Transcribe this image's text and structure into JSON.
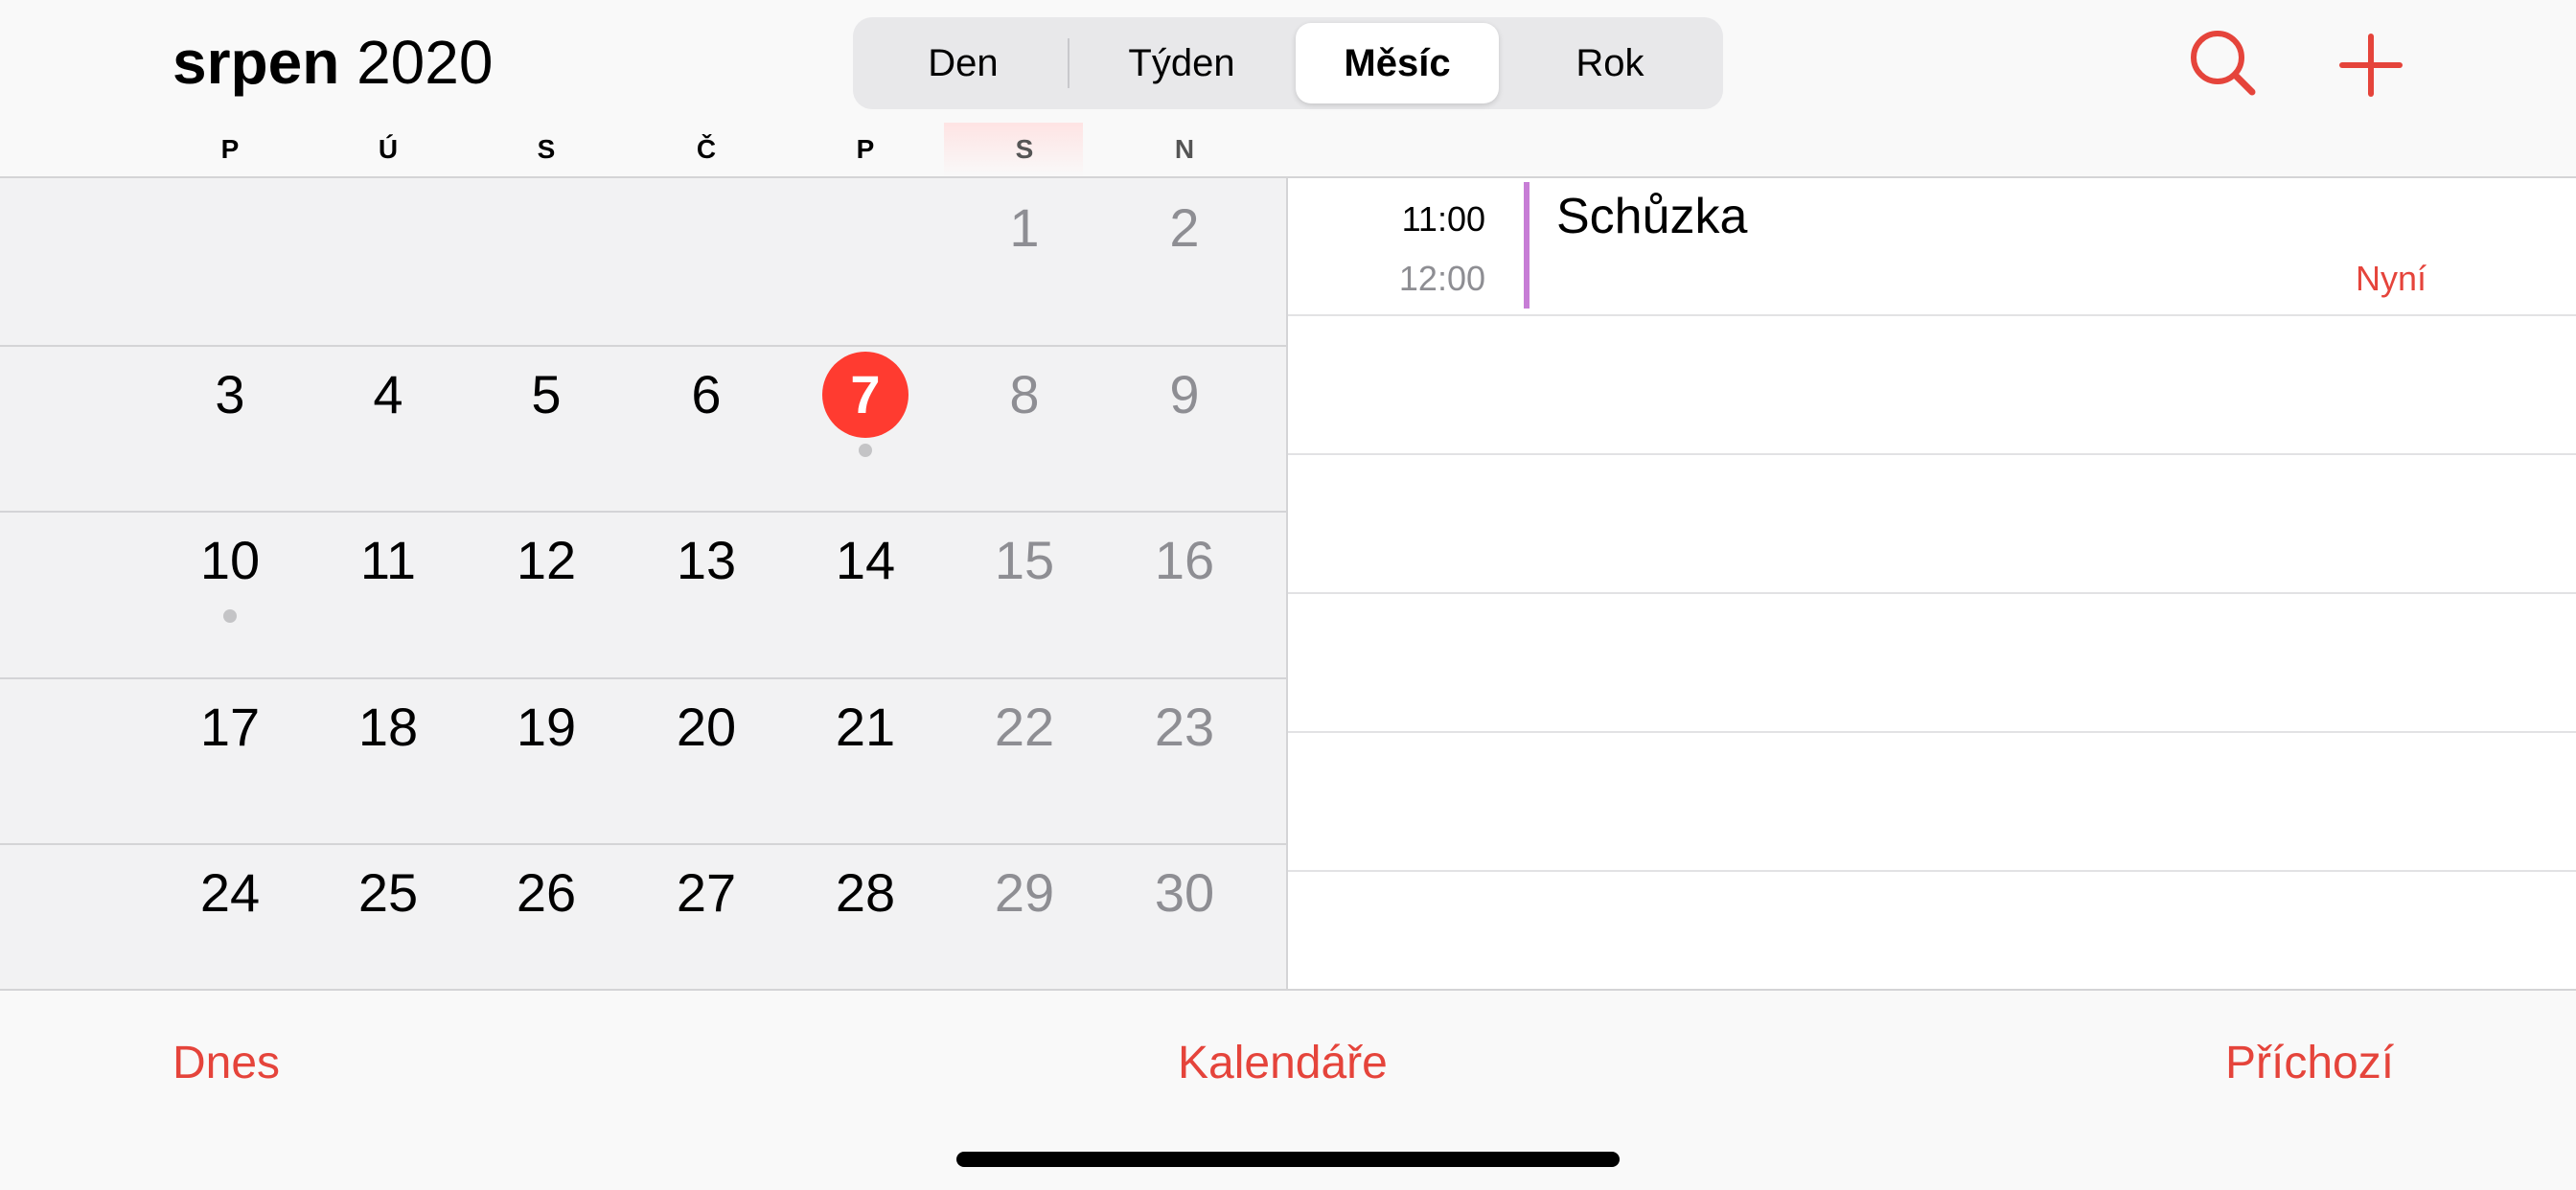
{
  "header": {
    "month": "srpen",
    "year": "2020",
    "segments": [
      {
        "label": "Den",
        "selected": false
      },
      {
        "label": "Týden",
        "selected": false
      },
      {
        "label": "Měsíc",
        "selected": true
      },
      {
        "label": "Rok",
        "selected": false
      }
    ],
    "search_icon": "magnifying-glass-icon",
    "add_icon": "plus-icon"
  },
  "weekdays": [
    "P",
    "Ú",
    "S",
    "Č",
    "P",
    "S",
    "N"
  ],
  "calendar": {
    "today": "7",
    "weeks": [
      [
        "",
        "",
        "",
        "",
        "",
        "1",
        "2"
      ],
      [
        "3",
        "4",
        "5",
        "6",
        "7",
        "8",
        "9"
      ],
      [
        "10",
        "11",
        "12",
        "13",
        "14",
        "15",
        "16"
      ],
      [
        "17",
        "18",
        "19",
        "20",
        "21",
        "22",
        "23"
      ],
      [
        "24",
        "25",
        "26",
        "27",
        "28",
        "29",
        "30"
      ]
    ],
    "days_with_events": [
      "7",
      "10"
    ]
  },
  "events": [
    {
      "start": "11:00",
      "end": "12:00",
      "title": "Schůzka",
      "status": "Nyní",
      "color": "#c77dd6"
    }
  ],
  "toolbar": {
    "today": "Dnes",
    "calendars": "Kalendáře",
    "inbox": "Příchozí"
  },
  "colors": {
    "accent": "#e5443b",
    "today_circle": "#ff3b30",
    "weekend_text": "#8e8e93"
  }
}
